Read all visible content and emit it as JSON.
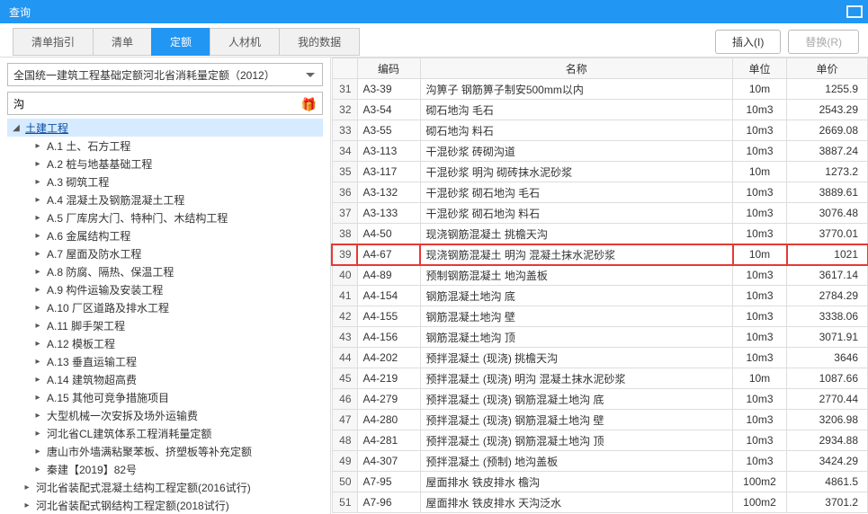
{
  "titlebar": {
    "title": "查询"
  },
  "tabs": {
    "items": [
      {
        "label": "清单指引"
      },
      {
        "label": "清单"
      },
      {
        "label": "定额"
      },
      {
        "label": "人材机"
      },
      {
        "label": "我的数据"
      }
    ]
  },
  "buttons": {
    "insert": "插入(I)",
    "replace": "替换(R)"
  },
  "dropdown": {
    "value": "全国统一建筑工程基础定额河北省消耗量定额（2012）"
  },
  "search": {
    "value": "沟"
  },
  "tree": {
    "root": "土建工程",
    "children": [
      "A.1 土、石方工程",
      "A.2 桩与地基基础工程",
      "A.3 砌筑工程",
      "A.4 混凝土及钢筋混凝土工程",
      "A.5 厂库房大门、特种门、木结构工程",
      "A.6 金属结构工程",
      "A.7 屋面及防水工程",
      "A.8 防腐、隔热、保温工程",
      "A.9 构件运输及安装工程",
      "A.10 厂区道路及排水工程",
      "A.11 脚手架工程",
      "A.12 模板工程",
      "A.13 垂直运输工程",
      "A.14 建筑物超高费",
      "A.15 其他可竞争措施项目",
      "大型机械一次安拆及场外运输费",
      "河北省CL建筑体系工程消耗量定额",
      "唐山市外墙满粘聚苯板、挤塑板等补充定额",
      "秦建【2019】82号"
    ],
    "siblings": [
      "河北省装配式混凝土结构工程定额(2016试行)",
      "河北省装配式钢结构工程定额(2018试行)"
    ]
  },
  "table": {
    "headers": {
      "c0": "",
      "c1": "编码",
      "c2": "名称",
      "c3": "单位",
      "c4": "单价"
    },
    "rows": [
      {
        "n": "31",
        "code": "A3-39",
        "name": "沟箅子 钢筋箅子制安500mm以内",
        "unit": "10m",
        "price": "1255.9"
      },
      {
        "n": "32",
        "code": "A3-54",
        "name": "砌石地沟 毛石",
        "unit": "10m3",
        "price": "2543.29"
      },
      {
        "n": "33",
        "code": "A3-55",
        "name": "砌石地沟 料石",
        "unit": "10m3",
        "price": "2669.08"
      },
      {
        "n": "34",
        "code": "A3-113",
        "name": "干混砂浆 砖砌沟道",
        "unit": "10m3",
        "price": "3887.24"
      },
      {
        "n": "35",
        "code": "A3-117",
        "name": "干混砂浆 明沟 砌砖抹水泥砂浆",
        "unit": "10m",
        "price": "1273.2"
      },
      {
        "n": "36",
        "code": "A3-132",
        "name": "干混砂浆 砌石地沟 毛石",
        "unit": "10m3",
        "price": "3889.61"
      },
      {
        "n": "37",
        "code": "A3-133",
        "name": "干混砂浆 砌石地沟 料石",
        "unit": "10m3",
        "price": "3076.48"
      },
      {
        "n": "38",
        "code": "A4-50",
        "name": "现浇钢筋混凝土 挑檐天沟",
        "unit": "10m3",
        "price": "3770.01"
      },
      {
        "n": "39",
        "code": "A4-67",
        "name": "现浇钢筋混凝土 明沟 混凝土抹水泥砂浆",
        "unit": "10m",
        "price": "1021",
        "hl": true
      },
      {
        "n": "40",
        "code": "A4-89",
        "name": "预制钢筋混凝土 地沟盖板",
        "unit": "10m3",
        "price": "3617.14"
      },
      {
        "n": "41",
        "code": "A4-154",
        "name": "钢筋混凝土地沟 底",
        "unit": "10m3",
        "price": "2784.29"
      },
      {
        "n": "42",
        "code": "A4-155",
        "name": "钢筋混凝土地沟 壁",
        "unit": "10m3",
        "price": "3338.06"
      },
      {
        "n": "43",
        "code": "A4-156",
        "name": "钢筋混凝土地沟 顶",
        "unit": "10m3",
        "price": "3071.91"
      },
      {
        "n": "44",
        "code": "A4-202",
        "name": "预拌混凝土 (现浇) 挑檐天沟",
        "unit": "10m3",
        "price": "3646"
      },
      {
        "n": "45",
        "code": "A4-219",
        "name": "预拌混凝土 (现浇) 明沟 混凝土抹水泥砂浆",
        "unit": "10m",
        "price": "1087.66"
      },
      {
        "n": "46",
        "code": "A4-279",
        "name": "预拌混凝土 (现浇) 钢筋混凝土地沟 底",
        "unit": "10m3",
        "price": "2770.44"
      },
      {
        "n": "47",
        "code": "A4-280",
        "name": "预拌混凝土 (现浇) 钢筋混凝土地沟 壁",
        "unit": "10m3",
        "price": "3206.98"
      },
      {
        "n": "48",
        "code": "A4-281",
        "name": "预拌混凝土 (现浇) 钢筋混凝土地沟 顶",
        "unit": "10m3",
        "price": "2934.88"
      },
      {
        "n": "49",
        "code": "A4-307",
        "name": "预拌混凝土 (预制) 地沟盖板",
        "unit": "10m3",
        "price": "3424.29"
      },
      {
        "n": "50",
        "code": "A7-95",
        "name": "屋面排水 铁皮排水 檐沟",
        "unit": "100m2",
        "price": "4861.5"
      },
      {
        "n": "51",
        "code": "A7-96",
        "name": "屋面排水 铁皮排水 天沟泛水",
        "unit": "100m2",
        "price": "3701.2"
      }
    ]
  }
}
